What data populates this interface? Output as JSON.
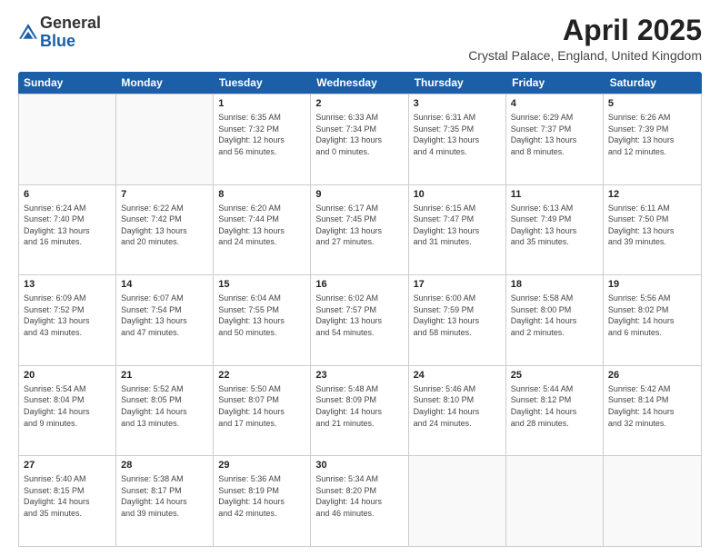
{
  "header": {
    "logo_general": "General",
    "logo_blue": "Blue",
    "month_title": "April 2025",
    "location": "Crystal Palace, England, United Kingdom"
  },
  "weekdays": [
    "Sunday",
    "Monday",
    "Tuesday",
    "Wednesday",
    "Thursday",
    "Friday",
    "Saturday"
  ],
  "rows": [
    [
      {
        "num": "",
        "detail": ""
      },
      {
        "num": "",
        "detail": ""
      },
      {
        "num": "1",
        "detail": "Sunrise: 6:35 AM\nSunset: 7:32 PM\nDaylight: 12 hours\nand 56 minutes."
      },
      {
        "num": "2",
        "detail": "Sunrise: 6:33 AM\nSunset: 7:34 PM\nDaylight: 13 hours\nand 0 minutes."
      },
      {
        "num": "3",
        "detail": "Sunrise: 6:31 AM\nSunset: 7:35 PM\nDaylight: 13 hours\nand 4 minutes."
      },
      {
        "num": "4",
        "detail": "Sunrise: 6:29 AM\nSunset: 7:37 PM\nDaylight: 13 hours\nand 8 minutes."
      },
      {
        "num": "5",
        "detail": "Sunrise: 6:26 AM\nSunset: 7:39 PM\nDaylight: 13 hours\nand 12 minutes."
      }
    ],
    [
      {
        "num": "6",
        "detail": "Sunrise: 6:24 AM\nSunset: 7:40 PM\nDaylight: 13 hours\nand 16 minutes."
      },
      {
        "num": "7",
        "detail": "Sunrise: 6:22 AM\nSunset: 7:42 PM\nDaylight: 13 hours\nand 20 minutes."
      },
      {
        "num": "8",
        "detail": "Sunrise: 6:20 AM\nSunset: 7:44 PM\nDaylight: 13 hours\nand 24 minutes."
      },
      {
        "num": "9",
        "detail": "Sunrise: 6:17 AM\nSunset: 7:45 PM\nDaylight: 13 hours\nand 27 minutes."
      },
      {
        "num": "10",
        "detail": "Sunrise: 6:15 AM\nSunset: 7:47 PM\nDaylight: 13 hours\nand 31 minutes."
      },
      {
        "num": "11",
        "detail": "Sunrise: 6:13 AM\nSunset: 7:49 PM\nDaylight: 13 hours\nand 35 minutes."
      },
      {
        "num": "12",
        "detail": "Sunrise: 6:11 AM\nSunset: 7:50 PM\nDaylight: 13 hours\nand 39 minutes."
      }
    ],
    [
      {
        "num": "13",
        "detail": "Sunrise: 6:09 AM\nSunset: 7:52 PM\nDaylight: 13 hours\nand 43 minutes."
      },
      {
        "num": "14",
        "detail": "Sunrise: 6:07 AM\nSunset: 7:54 PM\nDaylight: 13 hours\nand 47 minutes."
      },
      {
        "num": "15",
        "detail": "Sunrise: 6:04 AM\nSunset: 7:55 PM\nDaylight: 13 hours\nand 50 minutes."
      },
      {
        "num": "16",
        "detail": "Sunrise: 6:02 AM\nSunset: 7:57 PM\nDaylight: 13 hours\nand 54 minutes."
      },
      {
        "num": "17",
        "detail": "Sunrise: 6:00 AM\nSunset: 7:59 PM\nDaylight: 13 hours\nand 58 minutes."
      },
      {
        "num": "18",
        "detail": "Sunrise: 5:58 AM\nSunset: 8:00 PM\nDaylight: 14 hours\nand 2 minutes."
      },
      {
        "num": "19",
        "detail": "Sunrise: 5:56 AM\nSunset: 8:02 PM\nDaylight: 14 hours\nand 6 minutes."
      }
    ],
    [
      {
        "num": "20",
        "detail": "Sunrise: 5:54 AM\nSunset: 8:04 PM\nDaylight: 14 hours\nand 9 minutes."
      },
      {
        "num": "21",
        "detail": "Sunrise: 5:52 AM\nSunset: 8:05 PM\nDaylight: 14 hours\nand 13 minutes."
      },
      {
        "num": "22",
        "detail": "Sunrise: 5:50 AM\nSunset: 8:07 PM\nDaylight: 14 hours\nand 17 minutes."
      },
      {
        "num": "23",
        "detail": "Sunrise: 5:48 AM\nSunset: 8:09 PM\nDaylight: 14 hours\nand 21 minutes."
      },
      {
        "num": "24",
        "detail": "Sunrise: 5:46 AM\nSunset: 8:10 PM\nDaylight: 14 hours\nand 24 minutes."
      },
      {
        "num": "25",
        "detail": "Sunrise: 5:44 AM\nSunset: 8:12 PM\nDaylight: 14 hours\nand 28 minutes."
      },
      {
        "num": "26",
        "detail": "Sunrise: 5:42 AM\nSunset: 8:14 PM\nDaylight: 14 hours\nand 32 minutes."
      }
    ],
    [
      {
        "num": "27",
        "detail": "Sunrise: 5:40 AM\nSunset: 8:15 PM\nDaylight: 14 hours\nand 35 minutes."
      },
      {
        "num": "28",
        "detail": "Sunrise: 5:38 AM\nSunset: 8:17 PM\nDaylight: 14 hours\nand 39 minutes."
      },
      {
        "num": "29",
        "detail": "Sunrise: 5:36 AM\nSunset: 8:19 PM\nDaylight: 14 hours\nand 42 minutes."
      },
      {
        "num": "30",
        "detail": "Sunrise: 5:34 AM\nSunset: 8:20 PM\nDaylight: 14 hours\nand 46 minutes."
      },
      {
        "num": "",
        "detail": ""
      },
      {
        "num": "",
        "detail": ""
      },
      {
        "num": "",
        "detail": ""
      }
    ]
  ]
}
